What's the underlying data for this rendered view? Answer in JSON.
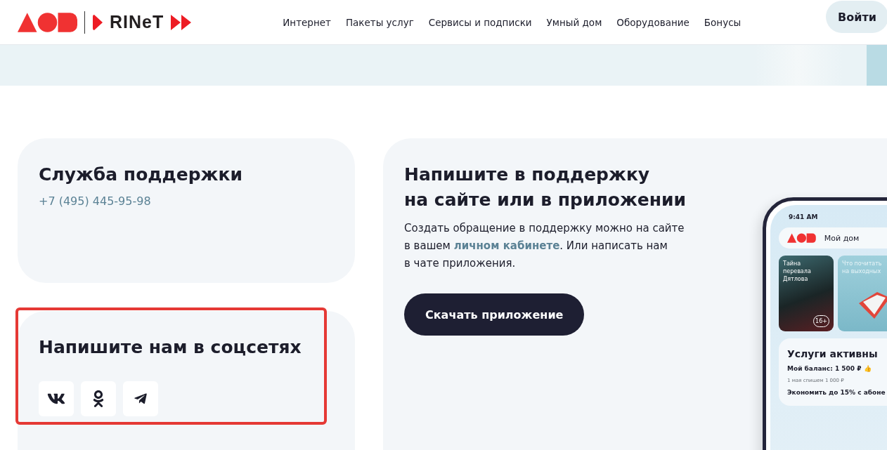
{
  "header": {
    "brand": "RINeT",
    "nav": [
      "Интернет",
      "Пакеты услуг",
      "Сервисы и подписки",
      "Умный дом",
      "Оборудование",
      "Бонусы"
    ],
    "login_button": "Войти"
  },
  "support_card": {
    "title": "Служба поддержки",
    "phone": "+7 (495) 445-95-98"
  },
  "social_card": {
    "title": "Напишите нам в соцсетях",
    "highlighted": true,
    "links": [
      {
        "kind": "vk"
      },
      {
        "kind": "ok"
      },
      {
        "kind": "telegram"
      }
    ]
  },
  "app_card": {
    "title": "Напишите в поддержку\nна сайте или в приложении",
    "text": "Создать обращение в поддержку можно на сайте\nв вашем **личном кабинете**. Или написать нам\nв чате приложения.",
    "button": "Скачать приложение",
    "phone": {
      "time": "9:41 AM",
      "app_title": "Мой дом",
      "stories": [
        {
          "kind": "photo",
          "title": "Тайна перевала Дятлова",
          "badge": "16+"
        },
        {
          "kind": "book",
          "title": "Что почитать на выходных"
        }
      ],
      "panel_title": "Услуги активны",
      "balance": "Мой баланс: 1 500 ₽ 👍",
      "charge": "1 мая спишем 1 000 ₽",
      "offer": "Экономить до 15% с абоне"
    }
  }
}
